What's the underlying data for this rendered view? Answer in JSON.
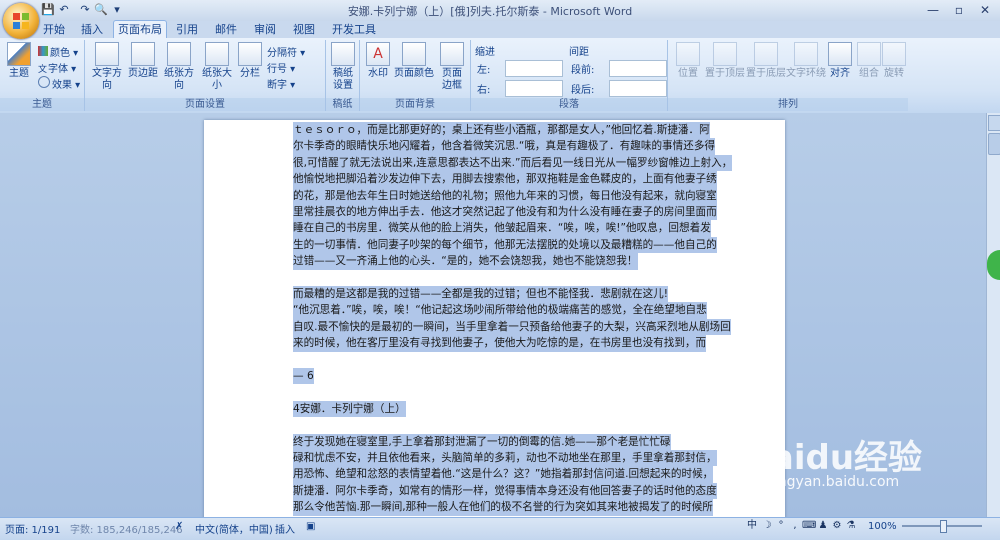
{
  "window": {
    "title": "安娜.卡列宁娜（上）[俄]列夫.托尔斯泰 - Microsoft Word",
    "controls": [
      "—",
      "▫",
      "✕"
    ]
  },
  "qat": [
    "💾",
    "↶",
    "↷",
    "🔍",
    "▾"
  ],
  "tabs": [
    "开始",
    "插入",
    "页面布局",
    "引用",
    "邮件",
    "审阅",
    "视图",
    "开发工具"
  ],
  "active_tab": "页面布局",
  "ribbon": {
    "theme": {
      "main": "主题",
      "colors": "颜色 ▾",
      "fonts": "字体 ▾",
      "effects": "效果 ▾",
      "group": "主题"
    },
    "page_setup": {
      "text_direction": "文字方向",
      "margins": "页边距",
      "orientation": "纸张方向",
      "size": "纸张大小",
      "columns": "分栏",
      "breaks": "分隔符 ▾",
      "line_numbers": "行号 ▾",
      "hyphenation": "断字 ▾",
      "group": "页面设置"
    },
    "draft": {
      "label": "稿纸\n设置",
      "group": "稿纸"
    },
    "page_background": {
      "watermark": "水印",
      "page_color": "页面颜色",
      "page_borders": "页面\n边框",
      "group": "页面背景"
    },
    "paragraph": {
      "indent": "缩进",
      "left": "左:",
      "right": "右:",
      "spacing": "间距",
      "before": "段前:",
      "after": "段后:",
      "group": "段落"
    },
    "arrange": {
      "position": "位置",
      "bring_front": "置于顶层",
      "send_back": "置于底层",
      "wrap": "文字环绕",
      "align": "对齐",
      "group_btn": "组合",
      "rotate": "旋转",
      "group": "排列"
    }
  },
  "document": {
    "lines": [
      "ｔｅｓｏｒｏ，而是比那更好的；桌上还有些小酒瓶，那都是女人，”他回忆着.斯捷潘．阿",
      "尔卡季奇的眼睛快乐地闪耀着，他含着微笑沉思.“哦，真是有趣极了．有趣味的事情还多得",
      "很,可惜醒了就无法说出来,连意思都表达不出来.”而后看见一线日光从一幅罗纱窗帷边上射入，",
      "他愉悦地把脚沿着沙发边伸下去，用脚去搜索他，那双拖鞋是金色鞣皮的，上面有他妻子绣",
      "的花，那是他去年生日时她送给他的礼物；照他九年来的习惯，每日他没有起来，就向寝室",
      "里常挂晨衣的地方伸出手去．他这才突然记起了他没有和为什么没有睡在妻子的房间里面而",
      "睡在自己的书房里．微笑从他的脸上消失，他皱起眉来．“唉，唉，唉!”他叹息，回想着发",
      "生的一切事情．他同妻子吵架的每个细节，他那无法摆脱的处境以及最糟糕的——他自己的",
      "过错——又一齐涌上他的心头．“是的，她不会饶恕我，她也不能饶恕我！",
      "",
      "        而最糟的是这都是我的过错——全都是我的过错；但也不能怪我．悲剧就在这儿!",
      "“他沉思着．”唉，唉，唉！“他记起这场吵闹所带给他的极端痛苦的感觉，全在绝望地自悲",
      "自叹.最不愉快的是最初的一瞬间，当手里拿着一只预备给他妻子的大梨，兴高采烈地从剧场回",
      "来的时候，他在客厅里没有寻找到他妻子，使他大为吃惊的是，在书房里也没有找到，而",
      "",
      "— 6",
      "",
      "        4安娜．卡列宁娜（上）",
      "",
      "        终于发现她在寝室里,手上拿着那封泄漏了一切的倒霉的信.她——那个老是忙忙碌",
      "碌和忧虑不安，并且依他看来，头脑简单的多莉，动也不动地坐在那里，手里拿着那封信，",
      "用恐怖、绝望和忿怒的表情望着他.“这是什么？这？”她指着那封信问道.回想起来的时候，",
      "斯捷潘．阿尔卡季奇，如常有的情形一样，觉得事情本身还没有他回答妻子的话时他的态度",
      "那么令他苦恼.那一瞬间,那种一般人在他们的极不名誉的行为突如其来地被揭发了的时候所"
    ]
  },
  "statusbar": {
    "page": "页面: 1/191",
    "words": "字数: 185,246/185,246",
    "language": "中文(简体，中国)",
    "mode": "插入",
    "zoom": "100%",
    "ime": [
      "中",
      "☽",
      "°",
      ",",
      "⌨",
      "♟",
      "⚙",
      "⚗"
    ]
  },
  "watermark": {
    "brand": "Baidu经验",
    "url": "jingyan.baidu.com"
  }
}
